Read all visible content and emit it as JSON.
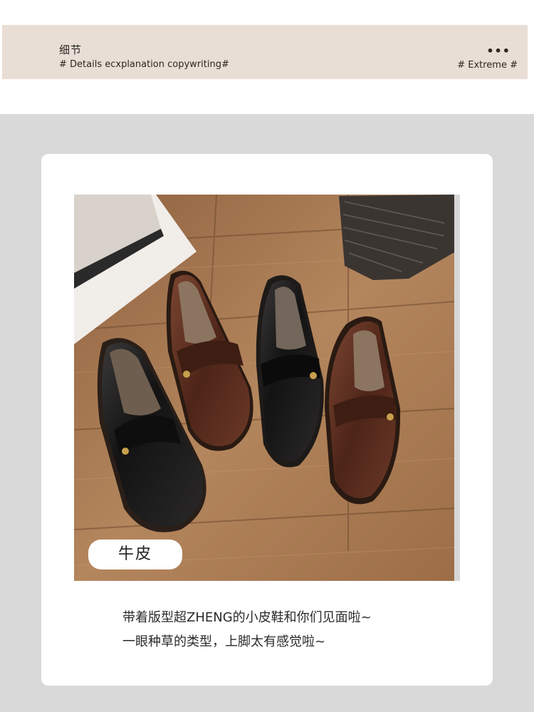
{
  "header": {
    "title_zh": "细节",
    "subtitle_en": "# Details ecxplanation  copywriting#",
    "dots": "•••",
    "tag": "# Extreme #"
  },
  "photo": {
    "badge_label": "牛皮"
  },
  "caption": {
    "line1": "带着版型超ZHENG的小皮鞋和你们见面啦~",
    "line2": "一眼种草的类型，上脚太有感觉啦~"
  },
  "colors": {
    "banner_bg": "#e9ded6",
    "section_bg": "#d9d9d9",
    "card_bg": "#ffffff",
    "shoe_black": "#1b1a1a",
    "shoe_brown": "#5a2e1f",
    "wood_floor": "#a87a52"
  }
}
